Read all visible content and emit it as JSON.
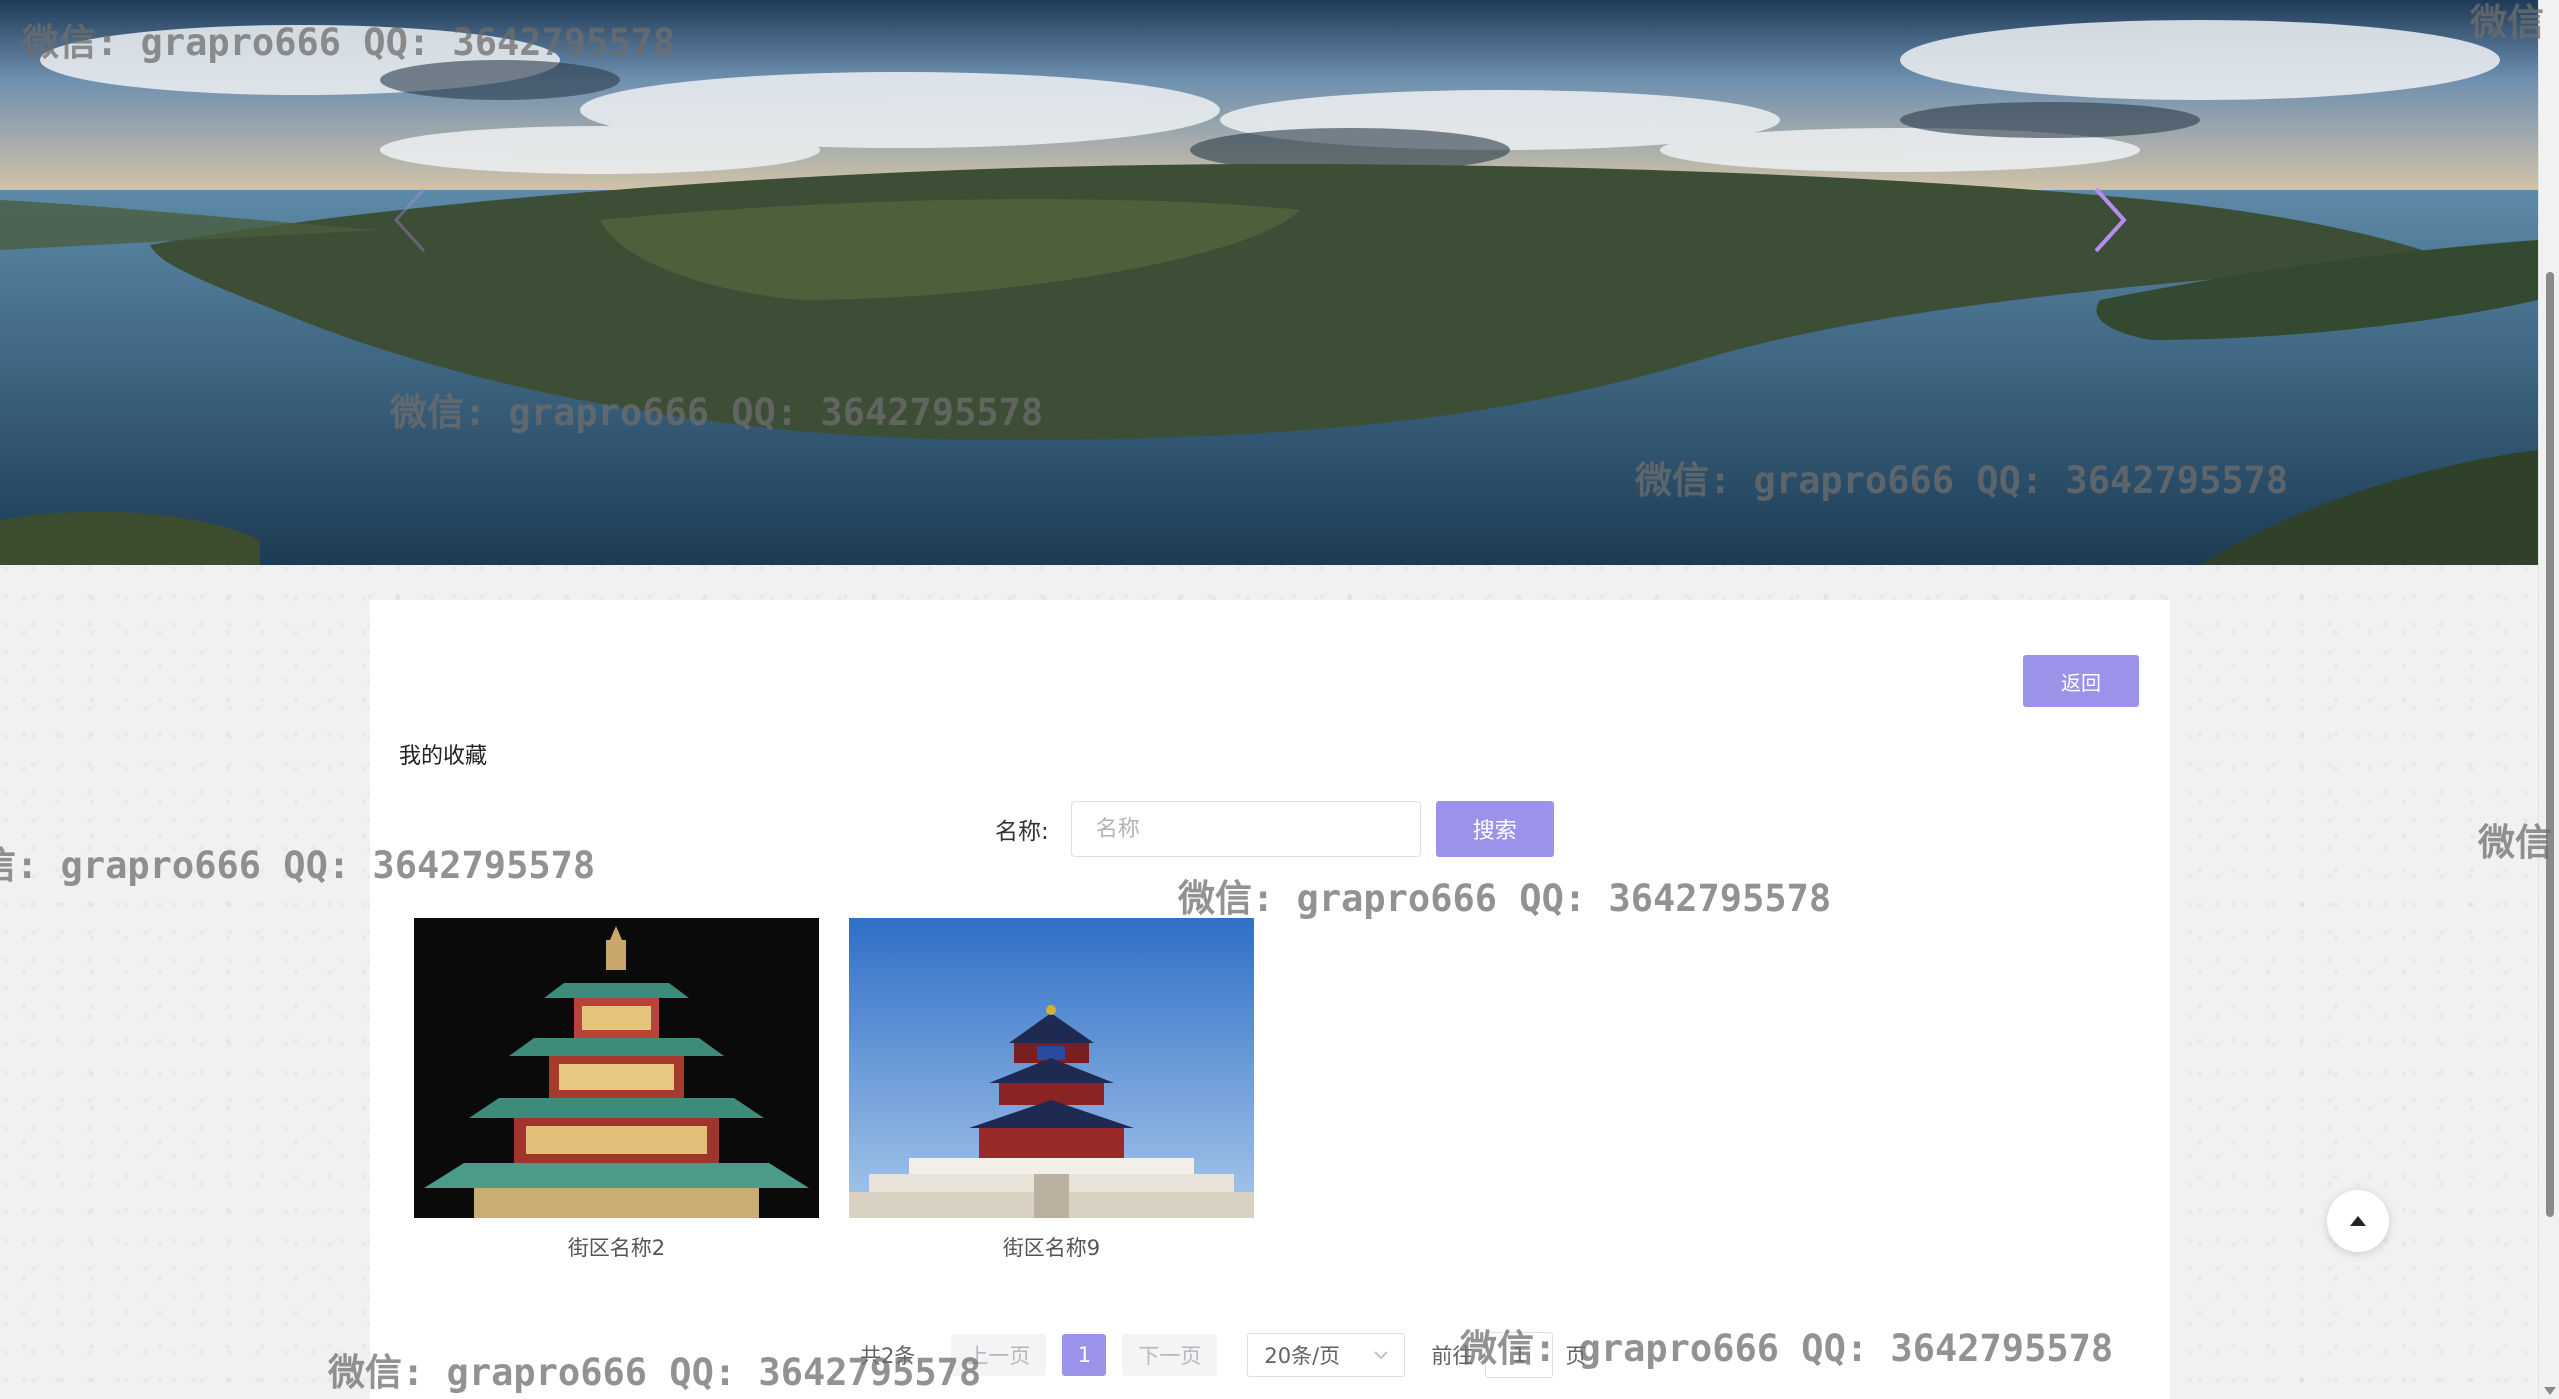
{
  "banner": {
    "prev_label": "previous slide",
    "next_label": "next slide",
    "arrow_color": "#b98cf0"
  },
  "panel": {
    "back_label": "返回",
    "title": "我的收藏"
  },
  "search": {
    "label": "名称:",
    "placeholder": "名称",
    "button_label": "搜索"
  },
  "items": [
    {
      "name": "街区名称2"
    },
    {
      "name": "街区名称9"
    }
  ],
  "pagination": {
    "total": "共2条",
    "prev_label": "上一页",
    "current_page": "1",
    "next_label": "下一页",
    "page_size": "20条/页",
    "goto_prefix": "前往",
    "goto_value": "1",
    "goto_suffix": "页"
  },
  "watermark": {
    "text": "微信: grapro666 QQ: 3642795578",
    "short": "微信"
  },
  "colors": {
    "accent": "#9b93e9"
  }
}
